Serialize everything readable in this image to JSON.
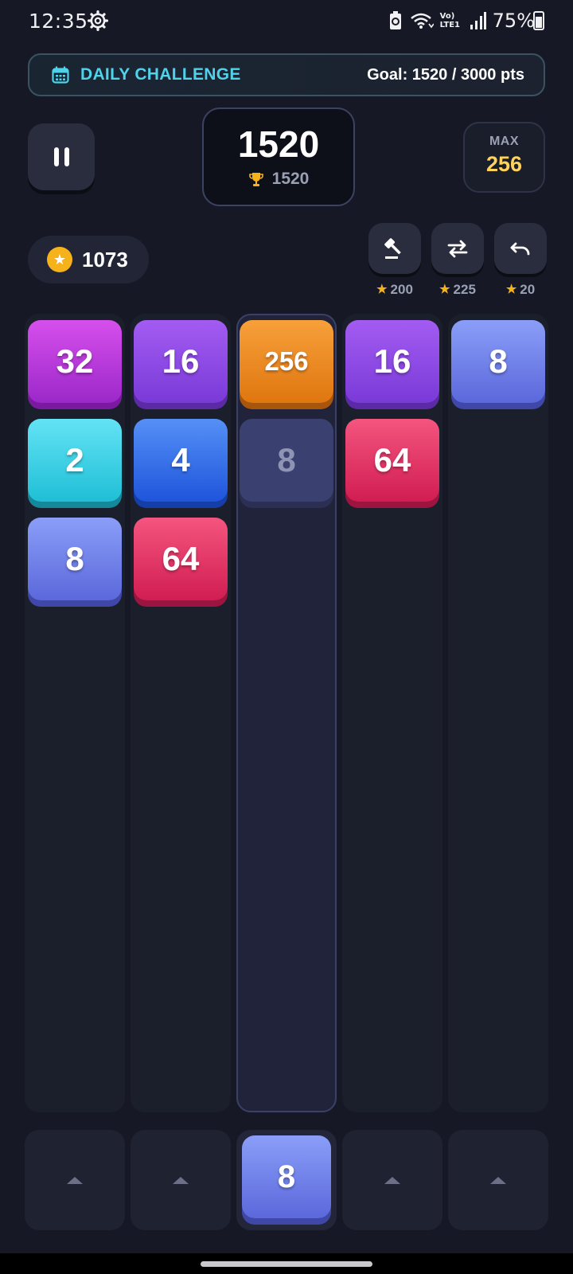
{
  "status_bar": {
    "time": "12:35",
    "battery_percent": "75%",
    "network_label": "Vo) LTE1"
  },
  "challenge": {
    "title": "DAILY CHALLENGE",
    "goal": "Goal: 1520 / 3000 pts",
    "accent_color": "#4fd3ea"
  },
  "score": {
    "current": "1520",
    "best": "1520"
  },
  "max_tile": {
    "label": "MAX",
    "value": "256"
  },
  "coins": {
    "value": "1073"
  },
  "powerups": [
    {
      "name": "hammer",
      "icon": "hammer-icon",
      "cost": "200"
    },
    {
      "name": "swap",
      "icon": "swap-arrows-icon",
      "cost": "225"
    },
    {
      "name": "undo",
      "icon": "undo-icon",
      "cost": "20"
    }
  ],
  "board": {
    "columns": [
      {
        "tiles": [
          {
            "value": "32",
            "color": "purple"
          },
          {
            "value": "2",
            "color": "cyan"
          },
          {
            "value": "8",
            "color": "periwinkle"
          }
        ]
      },
      {
        "tiles": [
          {
            "value": "16",
            "color": "violet"
          },
          {
            "value": "4",
            "color": "blue"
          },
          {
            "value": "64",
            "color": "pink"
          }
        ]
      },
      {
        "tiles": [
          {
            "value": "256",
            "color": "orange"
          },
          {
            "value": "8",
            "color": "ghost"
          }
        ],
        "active": true
      },
      {
        "tiles": [
          {
            "value": "16",
            "color": "violet"
          },
          {
            "value": "64",
            "color": "pink"
          }
        ]
      },
      {
        "tiles": [
          {
            "value": "8",
            "color": "periwinkle"
          }
        ]
      }
    ]
  },
  "next_tile": {
    "value": "8",
    "column": 3
  }
}
